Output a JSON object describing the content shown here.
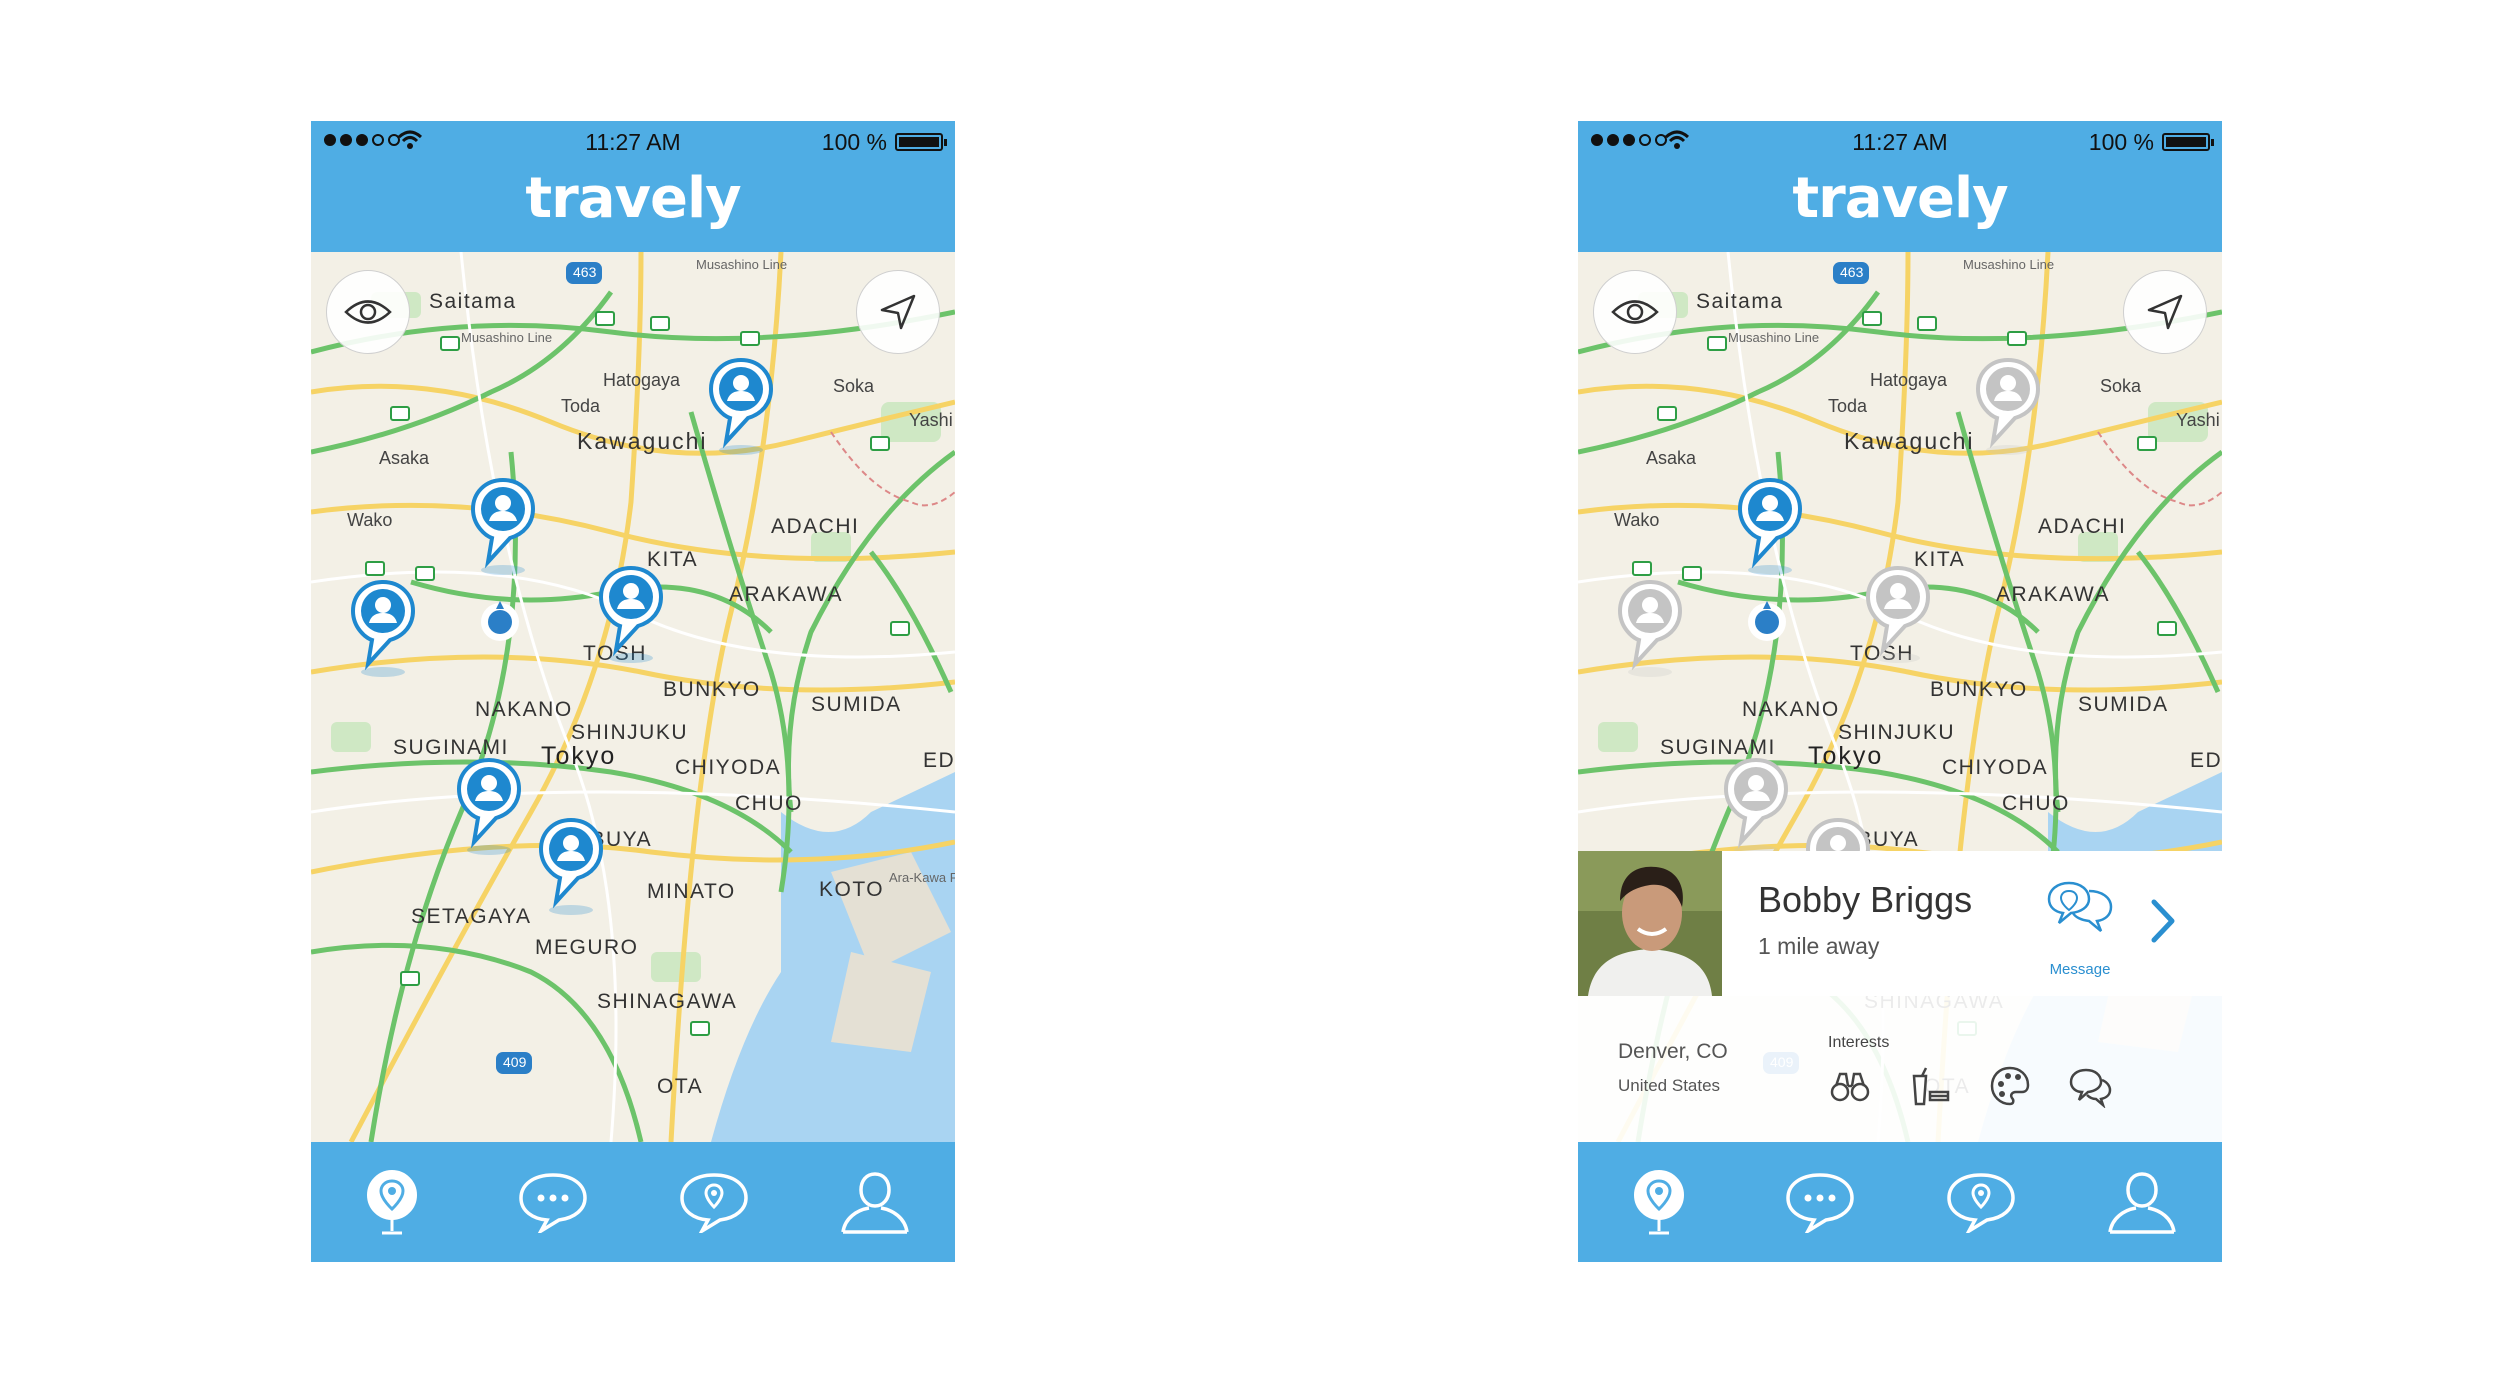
{
  "status_bar": {
    "time": "11:27 AM",
    "battery": "100 %"
  },
  "app": {
    "title": "travely"
  },
  "map_labels": [
    {
      "id": "saitama",
      "text": "Saitama"
    },
    {
      "id": "musashino_line_top",
      "text": "Musashino Line"
    },
    {
      "id": "musashino_line",
      "text": "Musashino Line"
    },
    {
      "id": "hatogaya",
      "text": "Hatogaya"
    },
    {
      "id": "soka",
      "text": "Soka"
    },
    {
      "id": "toda",
      "text": "Toda"
    },
    {
      "id": "yashi",
      "text": "Yashi"
    },
    {
      "id": "asaka",
      "text": "Asaka"
    },
    {
      "id": "kawaguchi",
      "text": "Kawaguchi"
    },
    {
      "id": "wako",
      "text": "Wako"
    },
    {
      "id": "adachi",
      "text": "ADACHI"
    },
    {
      "id": "kita",
      "text": "KITA"
    },
    {
      "id": "arakawa",
      "text": "ARAKAWA"
    },
    {
      "id": "tosh",
      "text": "TOSH"
    },
    {
      "id": "bunkyo",
      "text": "BUNKYO"
    },
    {
      "id": "sumida",
      "text": "SUMIDA"
    },
    {
      "id": "nakano",
      "text": "NAKANO"
    },
    {
      "id": "shinjuku",
      "text": "SHINJUKU"
    },
    {
      "id": "suginami",
      "text": "SUGINAMI"
    },
    {
      "id": "tokyo",
      "text": "Tokyo"
    },
    {
      "id": "chiyoda",
      "text": "CHIYODA"
    },
    {
      "id": "ed",
      "text": "ED"
    },
    {
      "id": "chuo",
      "text": "CHUO"
    },
    {
      "id": "shibuya",
      "text": "SHIBUYA"
    },
    {
      "id": "minato",
      "text": "MINATO"
    },
    {
      "id": "koto",
      "text": "KOTO"
    },
    {
      "id": "setagaya",
      "text": "SETAGAYA"
    },
    {
      "id": "meguro",
      "text": "MEGURO"
    },
    {
      "id": "shinagawa",
      "text": "SHINAGAWA"
    },
    {
      "id": "ota",
      "text": "OTA"
    },
    {
      "id": "arakawa_river",
      "text": "Ara-Kawa River"
    }
  ],
  "highway_badges": [
    "463",
    "409"
  ],
  "profile_card": {
    "name": "Bobby Briggs",
    "distance": "1 mile away",
    "message_label": "Message",
    "city": "Denver, CO",
    "country": "United States",
    "interests_label": "Interests",
    "interests": [
      "binoculars-icon",
      "food-drink-icon",
      "art-palette-icon",
      "chat-bubbles-icon"
    ]
  },
  "tabbar": {
    "items": [
      "map-pin-icon",
      "chat-icon",
      "location-chat-icon",
      "profile-icon"
    ],
    "selected": "map-pin-icon"
  },
  "colors": {
    "brand": "#4fade4",
    "pin_active": "#1e88cf",
    "pin_inactive": "#c4c4c4"
  }
}
